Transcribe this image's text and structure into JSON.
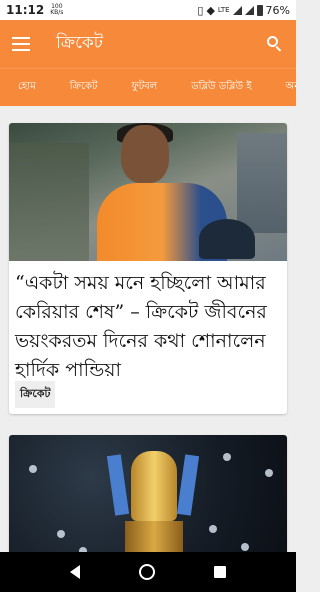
{
  "status_bar": {
    "time": "11:12",
    "net_speed_value": "100",
    "net_speed_unit": "KB/s",
    "battery_percent": "76%",
    "lte_label": "LTE"
  },
  "appbar": {
    "title": "ক্রিকেট"
  },
  "tabs": [
    {
      "label": "হোম"
    },
    {
      "label": "ক্রিকেট"
    },
    {
      "label": "ফুটবল"
    },
    {
      "label": "ডব্লিউ ডব্লিউ ই"
    },
    {
      "label": "অন্য"
    }
  ],
  "articles": [
    {
      "title": "“একটা সময় মনে হচ্ছিলো আমার কেরিয়ার শেষ” – ক্রিকেট জীবনের ভয়ংকরতম দিনের কথা শোনালেন হার্দিক পান্ডিয়া",
      "tag": "ক্রিকেট"
    },
    {
      "title": "",
      "tag": ""
    }
  ],
  "colors": {
    "accent": "#f6893a"
  }
}
